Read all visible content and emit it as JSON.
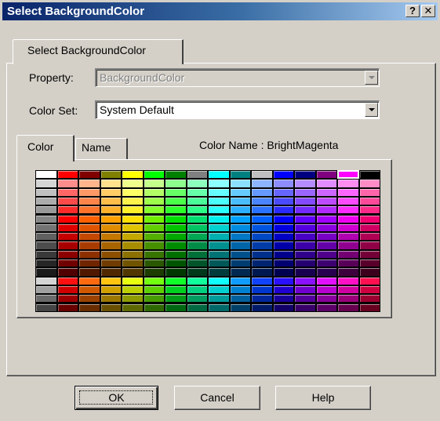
{
  "window": {
    "title": "Select BackgroundColor",
    "help_button": "?",
    "close_button": "✕"
  },
  "outer_tab": {
    "label": "Select BackgroundColor"
  },
  "property": {
    "label": "Property:",
    "value": "BackgroundColor",
    "disabled": true
  },
  "color_set": {
    "label": "Color Set:",
    "value": "System Default"
  },
  "tabs": {
    "color": "Color",
    "name": "Name"
  },
  "color_name_text": "Color Name : BrightMagenta",
  "palette": {
    "selected_color": "#ff00ff",
    "rows": [
      [
        "#ffffff",
        "#ff0000",
        "#800000",
        "#808000",
        "#ffff00",
        "#00ff00",
        "#008000",
        "#808080",
        "#00ffff",
        "#008080",
        "#c0c0c0",
        "#0000ff",
        "#000080",
        "#800080",
        "#ff00ff",
        "#000000"
      ],
      [
        "#d4d4d4",
        "#ff8c8c",
        "#ffb48c",
        "#ffe08c",
        "#f0ff8c",
        "#c4ff8c",
        "#8cff8c",
        "#8cffbc",
        "#8cffff",
        "#8ce0ff",
        "#8cb4ff",
        "#8c8cff",
        "#b48cff",
        "#e08cff",
        "#ff8cf0",
        "#ff8cc4"
      ],
      [
        "#c0c0c0",
        "#ff6666",
        "#ff9966",
        "#ffcc66",
        "#ffff66",
        "#b3ff66",
        "#66ff66",
        "#66ffaa",
        "#66ffff",
        "#66ccff",
        "#6699ff",
        "#6666ff",
        "#9966ff",
        "#cc66ff",
        "#ff66ff",
        "#ff66aa"
      ],
      [
        "#acacac",
        "#ff4a4a",
        "#ff844a",
        "#ffbd4a",
        "#fff24a",
        "#9dff4a",
        "#4aff4a",
        "#4aff99",
        "#4affff",
        "#4abdff",
        "#4a84ff",
        "#4a4aff",
        "#844aff",
        "#bd4aff",
        "#ff4aff",
        "#ff4a99"
      ],
      [
        "#999999",
        "#ff2a2a",
        "#ff722a",
        "#ffb02a",
        "#fff02a",
        "#85ff2a",
        "#2aff2a",
        "#2aff88",
        "#2affff",
        "#2ab0ff",
        "#2a72ff",
        "#2a2aff",
        "#722aff",
        "#b02aff",
        "#ff2aff",
        "#ff2a88"
      ],
      [
        "#868686",
        "#ff0000",
        "#ff6000",
        "#ffa000",
        "#ffe000",
        "#70f000",
        "#00e000",
        "#00e070",
        "#00f0f0",
        "#00a0ff",
        "#0060ff",
        "#0000ff",
        "#6000ff",
        "#a000ff",
        "#f000f0",
        "#f00070"
      ],
      [
        "#737373",
        "#e00000",
        "#e05400",
        "#e08c00",
        "#e0c400",
        "#62d000",
        "#00c400",
        "#00c462",
        "#00d0d0",
        "#008ce0",
        "#0054e0",
        "#0000e0",
        "#5400e0",
        "#8c00e0",
        "#d000d0",
        "#d00062"
      ],
      [
        "#606060",
        "#c40000",
        "#c44800",
        "#c47800",
        "#c4a800",
        "#54b000",
        "#00a800",
        "#00a854",
        "#00b0b0",
        "#0078c4",
        "#0048c4",
        "#0000c4",
        "#4800c4",
        "#7800c4",
        "#b000b0",
        "#b00054"
      ],
      [
        "#4d4d4d",
        "#a80000",
        "#a83c00",
        "#a86400",
        "#a88c00",
        "#469000",
        "#008c00",
        "#008c46",
        "#009090",
        "#0064a8",
        "#003ca8",
        "#0000a8",
        "#3c00a8",
        "#6400a8",
        "#900090",
        "#900046"
      ],
      [
        "#3a3a3a",
        "#8c0000",
        "#8c3000",
        "#8c5000",
        "#8c7000",
        "#387400",
        "#007000",
        "#007038",
        "#007474",
        "#00508c",
        "#00308c",
        "#00008c",
        "#30008c",
        "#50008c",
        "#740074",
        "#740038"
      ],
      [
        "#262626",
        "#700000",
        "#702400",
        "#703c00",
        "#705400",
        "#2a5800",
        "#005400",
        "#00542a",
        "#005858",
        "#003c70",
        "#002470",
        "#000070",
        "#240070",
        "#3c0070",
        "#580058",
        "#58002a"
      ],
      [
        "#1a1a1a",
        "#500000",
        "#501800",
        "#502800",
        "#503800",
        "#1c3c00",
        "#003800",
        "#00381c",
        "#003c3c",
        "#002850",
        "#001850",
        "#000050",
        "#180050",
        "#280050",
        "#3c003c",
        "#3c001c"
      ],
      [
        "#d4d4d4",
        "#ff1010",
        "#ff6a10",
        "#ffc410",
        "#e8ff10",
        "#72ff10",
        "#10ff2a",
        "#10ff9c",
        "#10ffff",
        "#109cff",
        "#1042ff",
        "#2a10ff",
        "#8a10ff",
        "#e010ff",
        "#ff10c4",
        "#ff1050"
      ],
      [
        "#a0a0a0",
        "#d00000",
        "#d05800",
        "#d0a000",
        "#bcd000",
        "#5cd000",
        "#00d020",
        "#00d080",
        "#00d0d0",
        "#0080d0",
        "#0036d0",
        "#2000d0",
        "#7000d0",
        "#b800d0",
        "#d000a0",
        "#d00040"
      ],
      [
        "#6a6a6a",
        "#9c0000",
        "#9c4200",
        "#9c7800",
        "#8e9c00",
        "#469c00",
        "#009c18",
        "#009c60",
        "#009c9c",
        "#00609c",
        "#00289c",
        "#18009c",
        "#54009c",
        "#8a009c",
        "#9c0078",
        "#9c0030"
      ],
      [
        "#444444",
        "#680000",
        "#682c00",
        "#685000",
        "#5e6800",
        "#2e6800",
        "#006810",
        "#006840",
        "#006868",
        "#004068",
        "#001a68",
        "#100068",
        "#380068",
        "#5c0068",
        "#680050",
        "#680020"
      ]
    ]
  },
  "buttons": {
    "ok": "OK",
    "cancel": "Cancel",
    "help": "Help"
  }
}
